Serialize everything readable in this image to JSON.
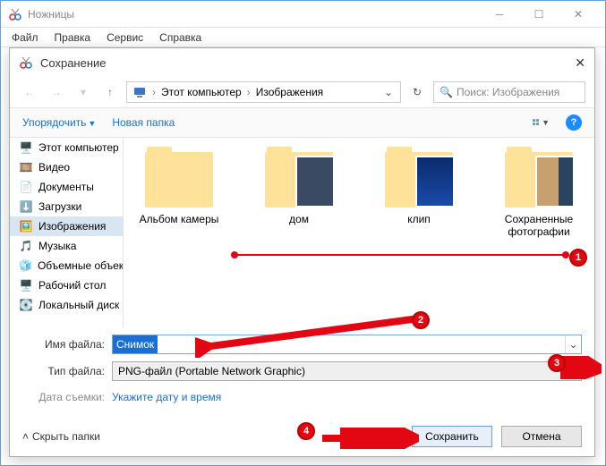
{
  "outer": {
    "title": "Ножницы",
    "menu": [
      "Файл",
      "Правка",
      "Сервис",
      "Справка"
    ]
  },
  "dialog": {
    "title": "Сохранение",
    "breadcrumb": {
      "root": "Этот компьютер",
      "folder": "Изображения"
    },
    "search_placeholder": "Поиск: Изображения",
    "organize": "Упорядочить",
    "new_folder": "Новая папка",
    "sidebar": [
      {
        "icon": "pc",
        "label": "Этот компьютер"
      },
      {
        "icon": "video",
        "label": "Видео"
      },
      {
        "icon": "doc",
        "label": "Документы"
      },
      {
        "icon": "dl",
        "label": "Загрузки"
      },
      {
        "icon": "img",
        "label": "Изображения",
        "selected": true
      },
      {
        "icon": "music",
        "label": "Музыка"
      },
      {
        "icon": "vol",
        "label": "Объемные объекты"
      },
      {
        "icon": "desk",
        "label": "Рабочий стол"
      },
      {
        "icon": "disk",
        "label": "Локальный диск"
      }
    ],
    "items": [
      {
        "label": "Альбом камеры",
        "type": "folder"
      },
      {
        "label": "дом",
        "type": "folder-overlay"
      },
      {
        "label": "клип",
        "type": "folder-blue"
      },
      {
        "label": "Сохраненные фотографии",
        "type": "folder-photo"
      }
    ],
    "filename_label": "Имя файла:",
    "filename_value": "Снимок",
    "filetype_label": "Тип файла:",
    "filetype_value": "PNG-файл (Portable Network Graphic)",
    "date_label": "Дата съемки:",
    "date_link": "Укажите дату и время",
    "hide_folders": "Скрыть папки",
    "save_btn": "Сохранить",
    "cancel_btn": "Отмена"
  }
}
